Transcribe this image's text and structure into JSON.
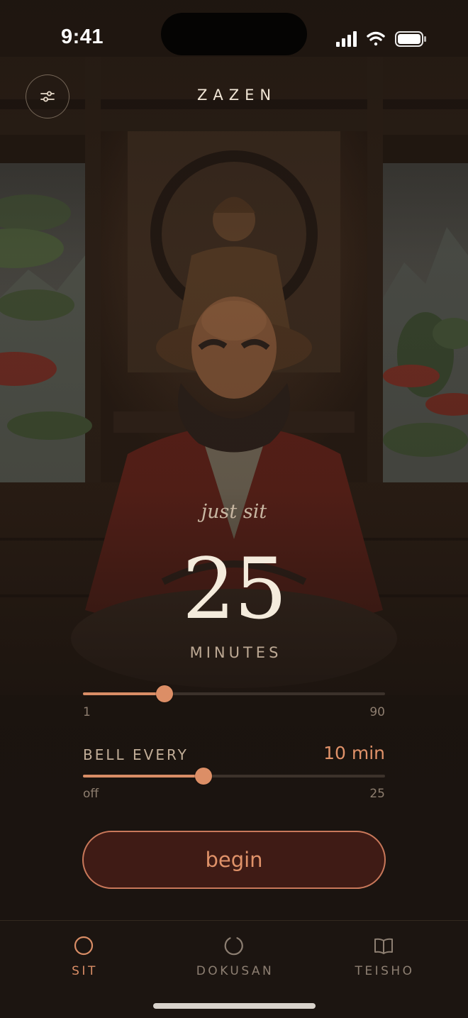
{
  "status_bar": {
    "time": "9:41"
  },
  "header": {
    "title": "ZAZEN",
    "settings_icon": "sliders-icon"
  },
  "timer": {
    "mantra": "just sit",
    "minutes": "25",
    "unit_label": "MINUTES",
    "duration_slider": {
      "min_label": "1",
      "max_label": "90",
      "min": 1,
      "max": 90,
      "value": 25
    }
  },
  "bell": {
    "label": "BELL EVERY",
    "value_label": "10 min",
    "slider": {
      "min_label": "off",
      "max_label": "25",
      "min": 0,
      "max": 25,
      "value": 10
    }
  },
  "actions": {
    "begin_label": "begin"
  },
  "tabs": [
    {
      "label": "SIT",
      "icon": "circle-icon",
      "active": true
    },
    {
      "label": "DOKUSAN",
      "icon": "enso-icon",
      "active": false
    },
    {
      "label": "TEISHO",
      "icon": "book-icon",
      "active": false
    }
  ],
  "colors": {
    "accent": "#d98d66",
    "background": "#1b1410",
    "button_fill": "#3f1b15"
  }
}
